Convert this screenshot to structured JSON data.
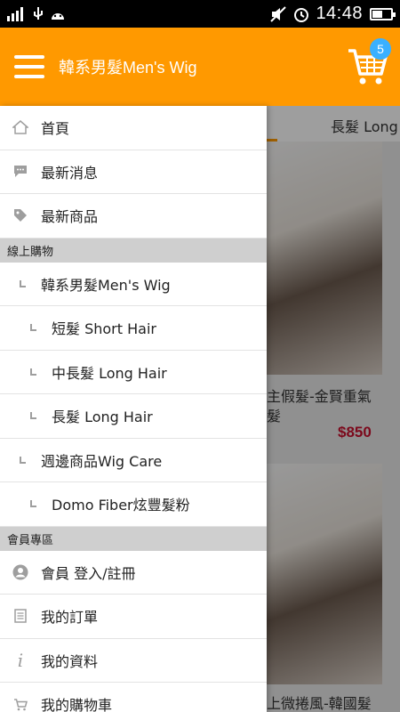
{
  "status_bar": {
    "time": "14:48",
    "carrier_icon": "signal-icon",
    "battery_level": 0.55
  },
  "app_bar": {
    "title": "韓系男髮Men's Wig",
    "cart_count": "5"
  },
  "background": {
    "tab_label": "長髮 Long",
    "products": [
      {
        "name": "主假髮-金賢重氣",
        "name2": "髮",
        "price": "$850"
      },
      {
        "name": "上微捲風-韓國髮",
        "price": ""
      }
    ]
  },
  "drawer": {
    "items": [
      {
        "icon": "home-icon",
        "label": "首頁"
      },
      {
        "icon": "chat-icon",
        "label": "最新消息"
      },
      {
        "icon": "tag-icon",
        "label": "最新商品"
      }
    ],
    "section_shop": "線上購物",
    "shop_items": [
      {
        "level": 1,
        "label": "韓系男髮Men's Wig"
      },
      {
        "level": 2,
        "label": "短髮 Short Hair"
      },
      {
        "level": 2,
        "label": "中長髮 Long Hair"
      },
      {
        "level": 2,
        "label": "長髮 Long Hair"
      },
      {
        "level": 1,
        "label": "週邊商品Wig Care"
      },
      {
        "level": 2,
        "label": "Domo Fiber炫豐髮粉"
      }
    ],
    "section_member": "會員專區",
    "member_items": [
      {
        "icon": "user-icon",
        "label": "會員 登入/註冊"
      },
      {
        "icon": "list-icon",
        "label": "我的訂單"
      },
      {
        "icon": "info-icon",
        "label": "我的資料"
      },
      {
        "icon": "cart-icon",
        "label": "我的購物車"
      }
    ]
  }
}
